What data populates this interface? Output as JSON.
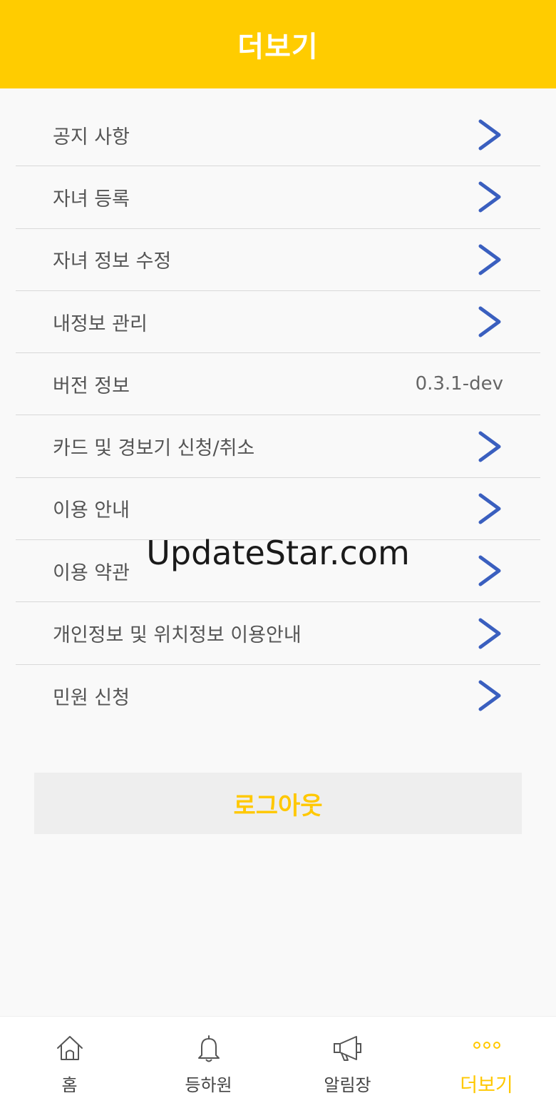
{
  "header": {
    "title": "더보기"
  },
  "menu": {
    "items": [
      {
        "label": "공지 사항"
      },
      {
        "label": "자녀 등록"
      },
      {
        "label": "자녀 정보 수정"
      },
      {
        "label": "내정보 관리"
      },
      {
        "label": "버전 정보",
        "value": "0.3.1-dev"
      },
      {
        "label": "카드 및 경보기 신청/취소"
      },
      {
        "label": "이용 안내"
      },
      {
        "label": "이용 약관"
      },
      {
        "label": "개인정보 및 위치정보 이용안내"
      },
      {
        "label": "민원 신청"
      }
    ]
  },
  "logout": {
    "label": "로그아웃"
  },
  "watermark": {
    "text": "UpdateStar.com"
  },
  "tabbar": {
    "tabs": [
      {
        "label": "홈",
        "icon": "home-icon"
      },
      {
        "label": "등하원",
        "icon": "bell-icon"
      },
      {
        "label": "알림장",
        "icon": "megaphone-icon"
      },
      {
        "label": "더보기",
        "icon": "more-icon",
        "active": true
      }
    ]
  },
  "colors": {
    "brand_yellow": "#ffcc00",
    "chevron_blue": "#3a5fbf",
    "active_tab": "#ffc800"
  }
}
